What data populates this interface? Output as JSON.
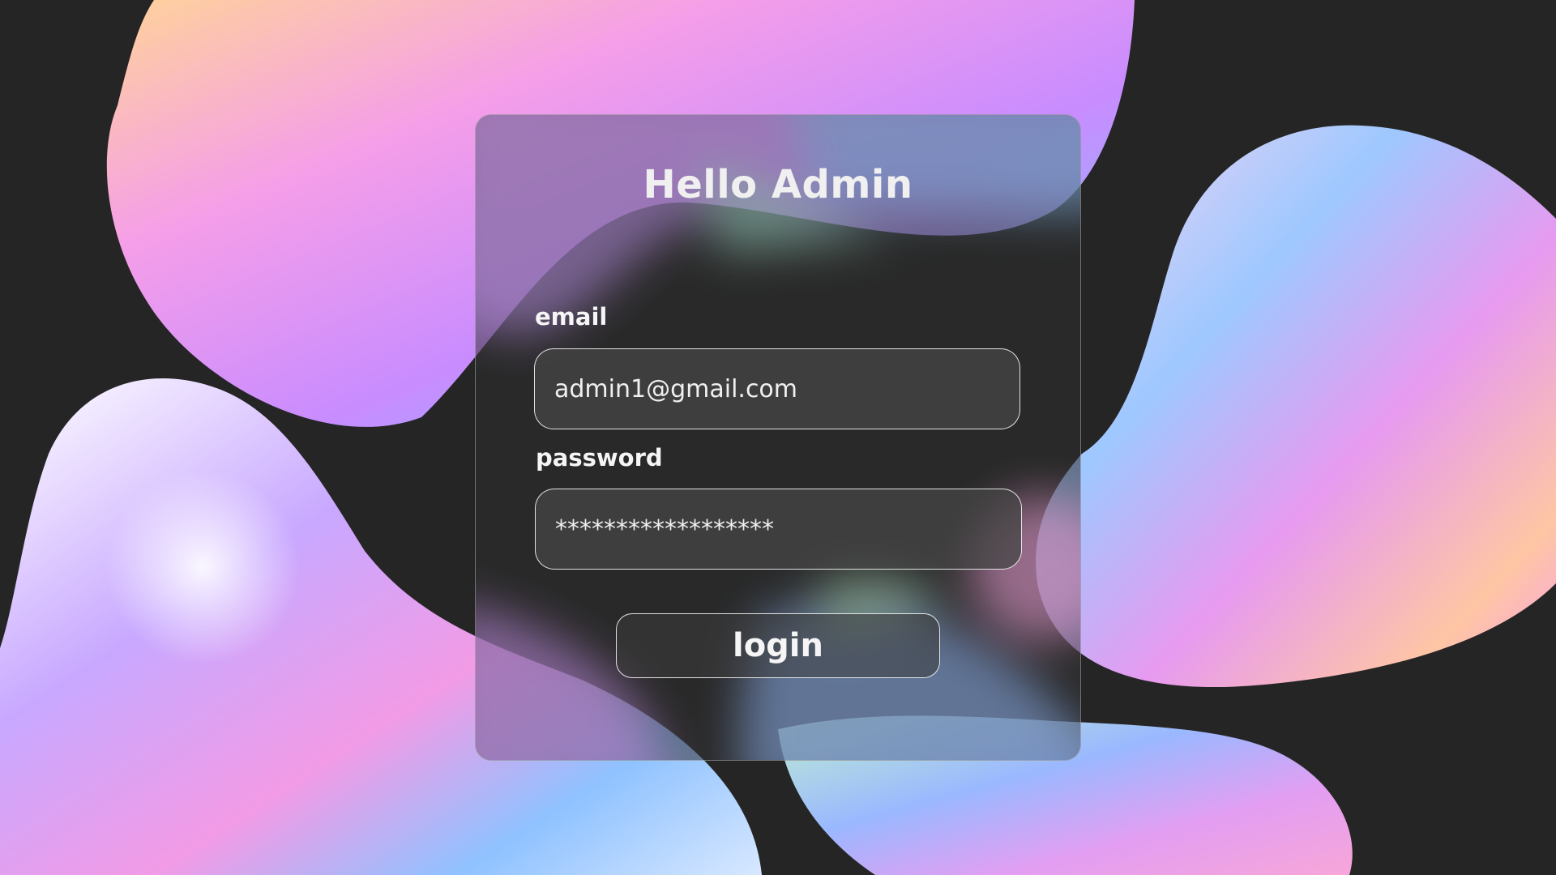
{
  "login": {
    "title": "Hello Admin",
    "email_label": "email",
    "email_value": "admin1@gmail.com",
    "password_label": "password",
    "password_value": "******************",
    "login_label": "login"
  },
  "colors": {
    "background": "#252525",
    "card": "#2d2d2d",
    "text": "#f0f0f0"
  }
}
